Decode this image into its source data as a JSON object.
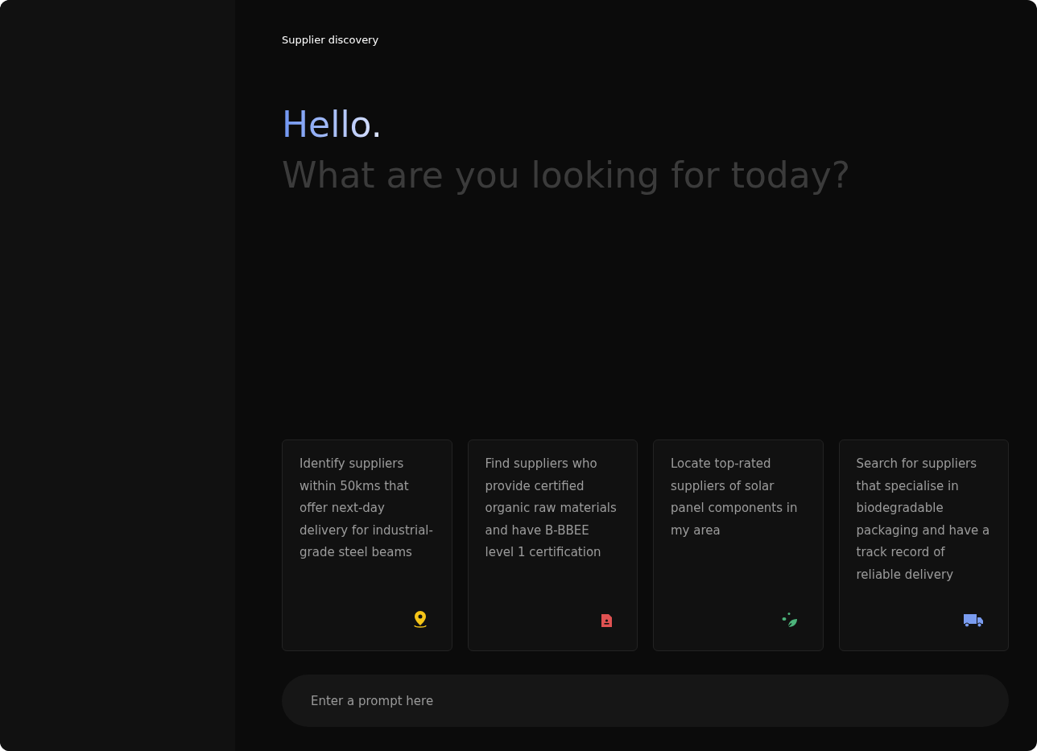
{
  "header": {
    "title": "Supplier discovery"
  },
  "greeting": {
    "hello": "Hello.",
    "question": "What are you looking for today?"
  },
  "suggestions": [
    {
      "text": "Identify suppliers within 50kms that offer next-day delivery for industrial-grade steel beams",
      "kind": "location",
      "color": "#f5c518"
    },
    {
      "text": "Find suppliers who provide certified organic raw materials and have B-BBEE level 1 certification",
      "kind": "document",
      "color": "#e05252"
    },
    {
      "text": "Locate top-rated suppliers of solar panel components in my area",
      "kind": "leaf",
      "color": "#4cb37a"
    },
    {
      "text": "Search for suppliers that specialise in biodegradable packaging and have a track record of reliable delivery",
      "kind": "truck",
      "color": "#7a9cf0"
    }
  ],
  "prompt": {
    "placeholder": "Enter a prompt here"
  }
}
